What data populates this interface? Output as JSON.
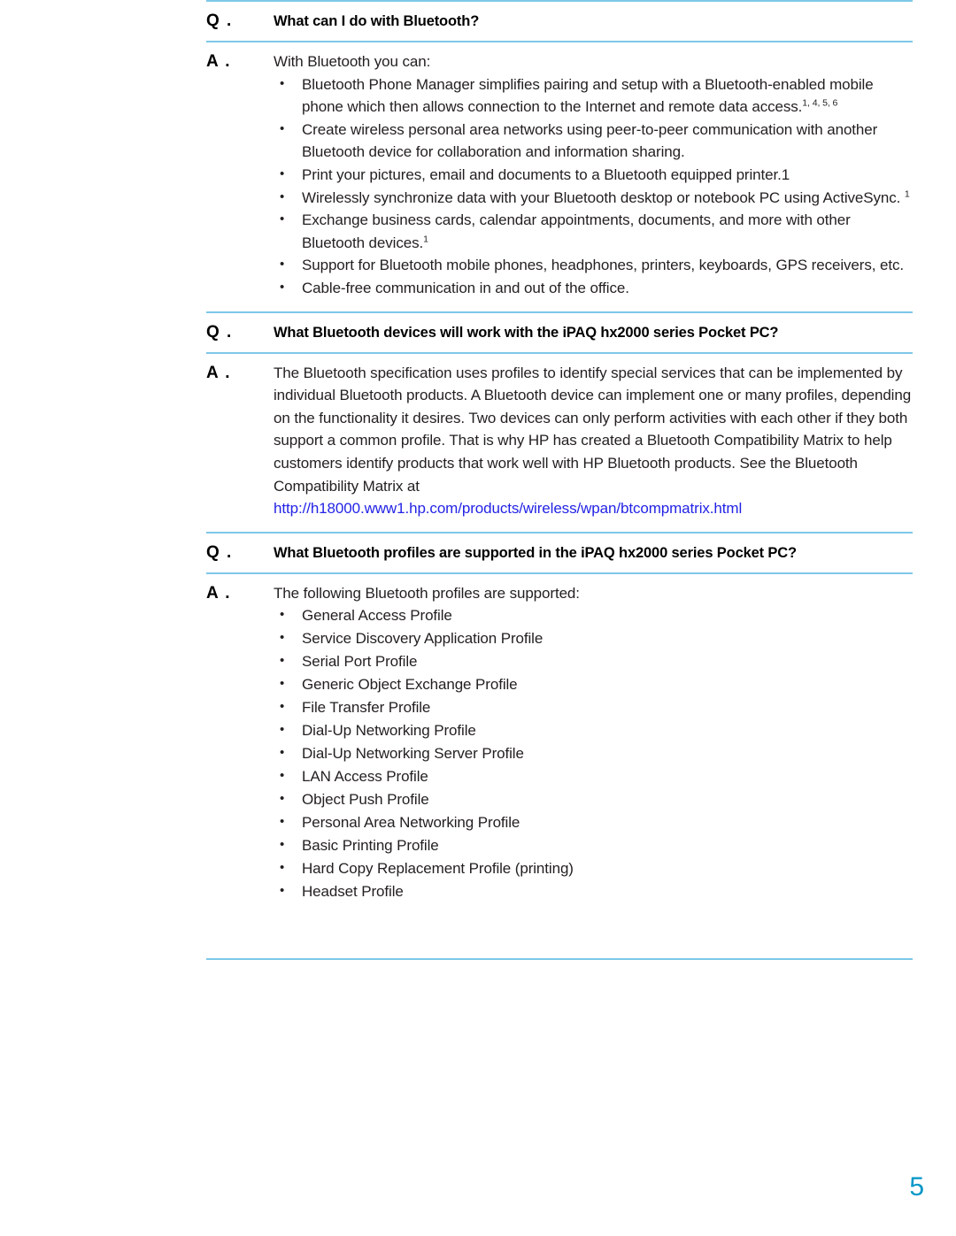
{
  "document": {
    "page_number": "5",
    "accent_rule_color": "#7ec8e8",
    "link_color": "#2323e6",
    "page_number_color": "#0096c8"
  },
  "sections": [
    {
      "q_label": "Q .",
      "question": "What can I do with Bluetooth?",
      "a_label": "A .",
      "answer_intro": "With Bluetooth you can:",
      "bullets": [
        {
          "text": "Bluetooth Phone Manager simplifies pairing and setup with a Bluetooth-enabled mobile phone which then allows connection to the Internet and remote data access.",
          "sup": "1, 4, 5, 6"
        },
        {
          "text": "Create wireless personal area networks using peer-to-peer communication with another Bluetooth device for collaboration and information sharing.",
          "sup": ""
        },
        {
          "text": "Print your pictures, email and documents to a Bluetooth equipped printer.1",
          "sup": ""
        },
        {
          "text": "Wirelessly synchronize data with your Bluetooth desktop or notebook PC using ActiveSync. ",
          "sup": "1"
        },
        {
          "text": "Exchange business cards, calendar appointments, documents, and more with other Bluetooth devices.",
          "sup": "1"
        },
        {
          "text": "Support for Bluetooth mobile phones, headphones, printers, keyboards, GPS receivers, etc.",
          "sup": ""
        },
        {
          "text": "Cable-free communication in and out of the office.",
          "sup": ""
        }
      ]
    },
    {
      "q_label": "Q .",
      "question": "What Bluetooth devices will work with the iPAQ hx2000 series Pocket PC?",
      "a_label": "A .",
      "answer_paragraph": "The Bluetooth specification uses profiles to identify special services that can be implemented by individual Bluetooth products. A Bluetooth device can implement one or many profiles, depending on the functionality it desires. Two devices can only perform activities with each other if they both support a common profile. That is why HP has created a Bluetooth Compatibility Matrix to help customers identify products that work well with HP Bluetooth products. See the Bluetooth Compatibility Matrix at",
      "link_text": "http://h18000.www1.hp.com/products/wireless/wpan/btcompmatrix.html"
    },
    {
      "q_label": "Q .",
      "question": "What Bluetooth profiles are supported in the iPAQ hx2000 series Pocket PC?",
      "a_label": "A .",
      "answer_intro": "The following Bluetooth profiles are supported:",
      "profiles": [
        "General Access Profile",
        "Service Discovery Application Profile",
        "Serial Port Profile",
        "Generic Object Exchange Profile",
        "File Transfer Profile",
        "Dial-Up Networking Profile",
        "Dial-Up Networking Server Profile",
        "LAN Access Profile",
        "Object Push Profile",
        "Personal Area Networking Profile",
        "Basic Printing Profile",
        "Hard Copy Replacement Profile (printing)",
        "Headset Profile"
      ]
    }
  ]
}
